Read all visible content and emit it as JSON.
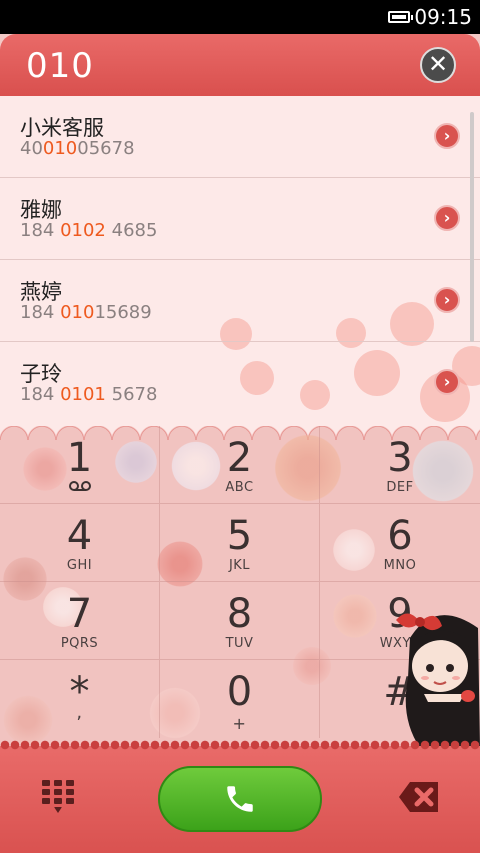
{
  "status_bar": {
    "time": "09:15"
  },
  "header": {
    "query": "010",
    "close_icon": "close-icon"
  },
  "contacts": [
    {
      "name": "小米客服",
      "num_pre": "40",
      "num_match": "010",
      "num_post": "05678"
    },
    {
      "name": "雅娜",
      "num_pre": "184 ",
      "num_match": "0102",
      "num_post": " 4685"
    },
    {
      "name": "燕婷",
      "num_pre": "184 ",
      "num_match": "010",
      "num_post": "15689"
    },
    {
      "name": "子玲",
      "num_pre": "184 ",
      "num_match": "0101",
      "num_post": " 5678"
    }
  ],
  "keypad": [
    {
      "digit": "1",
      "letters": ""
    },
    {
      "digit": "2",
      "letters": "ABC"
    },
    {
      "digit": "3",
      "letters": "DEF"
    },
    {
      "digit": "4",
      "letters": "GHI"
    },
    {
      "digit": "5",
      "letters": "JKL"
    },
    {
      "digit": "6",
      "letters": "MNO"
    },
    {
      "digit": "7",
      "letters": "PQRS"
    },
    {
      "digit": "8",
      "letters": "TUV"
    },
    {
      "digit": "9",
      "letters": "WXYZ"
    },
    {
      "digit": "*",
      "letters": ","
    },
    {
      "digit": "0",
      "letters": "+"
    },
    {
      "digit": "#",
      "letters": ""
    }
  ],
  "colors": {
    "accent": "#d9504e",
    "match": "#ee5a1f",
    "call": "#4cb024"
  }
}
